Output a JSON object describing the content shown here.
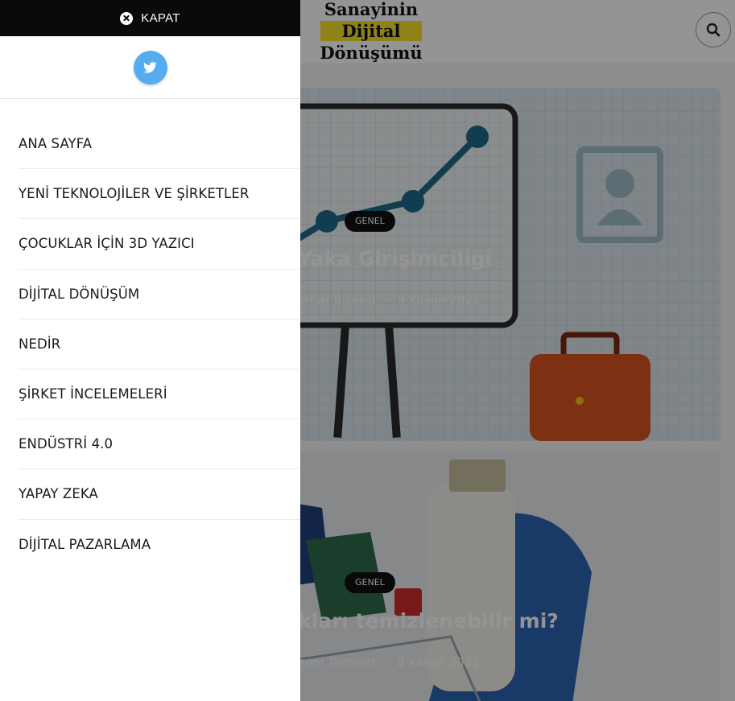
{
  "header": {
    "logo_lines": [
      "Sanayinin",
      "Dijital",
      "Dönüşümü"
    ],
    "search_icon": "search-icon"
  },
  "posts": [
    {
      "category": "GENEL",
      "title_visible": "Yaka Girişimciliği",
      "author_visible": "erhat Bıçakçı",
      "separator": "·",
      "date": "9 Kasım 2021"
    },
    {
      "category": "GENEL",
      "title_visible": "kları temizlenebilir mi?",
      "author_visible": "enol Tanrıver",
      "separator": "·",
      "date": "8 Kasım 2021"
    }
  ],
  "drawer": {
    "close_label": "KAPAT",
    "close_icon": "close-circle-icon",
    "social_icon": "twitter-icon",
    "colors": {
      "twitter": "#55acee",
      "close_bar": "#0a0a0a"
    },
    "menu": [
      "ANA SAYFA",
      "YENİ TEKNOLOJİLER VE ŞİRKETLER",
      "ÇOCUKLAR İÇİN 3D YAZICI",
      "DİJİTAL DÖNÜŞÜM",
      "NEDİR",
      "ŞİRKET İNCELEMELERİ",
      "ENDÜSTRİ 4.0",
      "YAPAY ZEKA",
      "DİJİTAL PAZARLAMA"
    ]
  }
}
